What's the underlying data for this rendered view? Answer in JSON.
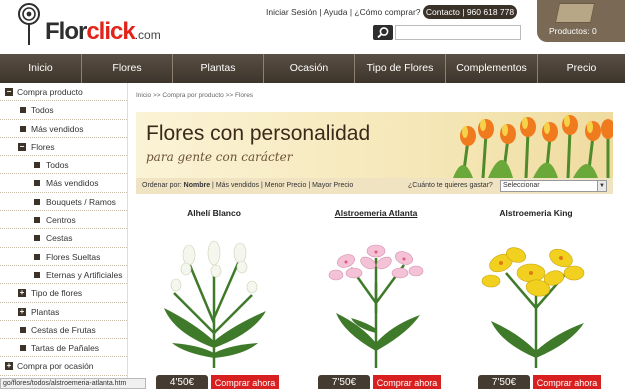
{
  "brand": {
    "logo_flor": "Flor",
    "logo_click": "click",
    "logo_com": ".com"
  },
  "header": {
    "top_links": [
      "Iniciar Sesión",
      "Ayuda",
      "¿Cómo comprar?"
    ],
    "separator": " | ",
    "contact_label": "Contacto | 960 618 778",
    "search_icon": "search-icon",
    "cart_label": "Productos: 0",
    "cart_icon": "cart-box-icon"
  },
  "nav": {
    "items": [
      "Inicio",
      "Flores",
      "Plantas",
      "Ocasión",
      "Tipo de Flores",
      "Complementos",
      "Precio"
    ]
  },
  "sidebar": {
    "items": [
      {
        "label": "Compra producto",
        "marker": "minus"
      },
      {
        "label": "Todos",
        "marker": "bullet"
      },
      {
        "label": "Más vendidos",
        "marker": "bullet"
      },
      {
        "label": "Flores",
        "marker": "minus"
      },
      {
        "label": "Todos",
        "marker": "bullet"
      },
      {
        "label": "Más vendidos",
        "marker": "bullet"
      },
      {
        "label": "Bouquets / Ramos",
        "marker": "bullet"
      },
      {
        "label": "Centros",
        "marker": "bullet"
      },
      {
        "label": "Cestas",
        "marker": "bullet"
      },
      {
        "label": "Flores Sueltas",
        "marker": "bullet"
      },
      {
        "label": "Eternas y Artificiales",
        "marker": "bullet"
      },
      {
        "label": "Tipo de flores",
        "marker": "plus"
      },
      {
        "label": "Plantas",
        "marker": "plus"
      },
      {
        "label": "Cestas de Frutas",
        "marker": "bullet"
      },
      {
        "label": "Tartas de Pañales",
        "marker": "bullet"
      },
      {
        "label": "Compra por ocasión",
        "marker": "plus"
      }
    ]
  },
  "main": {
    "breadcrumb": "Inicio >> Compra por producto >> Flores",
    "banner_title": "Flores con personalidad",
    "banner_subtitle": "para gente con carácter",
    "sort_label": "Ordenar por:",
    "sort_options": [
      "Nombre",
      "Más vendidos",
      "Menor Precio",
      "Mayor Precio"
    ],
    "budget_label": "¿Cuánto te quieres gastar?",
    "budget_select": "Seleccionar",
    "buy_label": "Comprar ahora"
  },
  "products": [
    {
      "name": "Alhelí Blanco",
      "price": "4'50€",
      "flower_color": "#ffffff"
    },
    {
      "name": "Alstroemeria Atlanta",
      "price": "7'50€",
      "flower_color": "#f2b8cf"
    },
    {
      "name": "Alstroemeria King",
      "price": "7'50€",
      "flower_color": "#f2d020"
    }
  ],
  "statusbar": {
    "url": "go/flores/todos/alstroemeria-atlanta.htm"
  },
  "colors": {
    "accent": "#e2231a",
    "nav_bg": "#4a3f35",
    "buy": "#d82020"
  }
}
